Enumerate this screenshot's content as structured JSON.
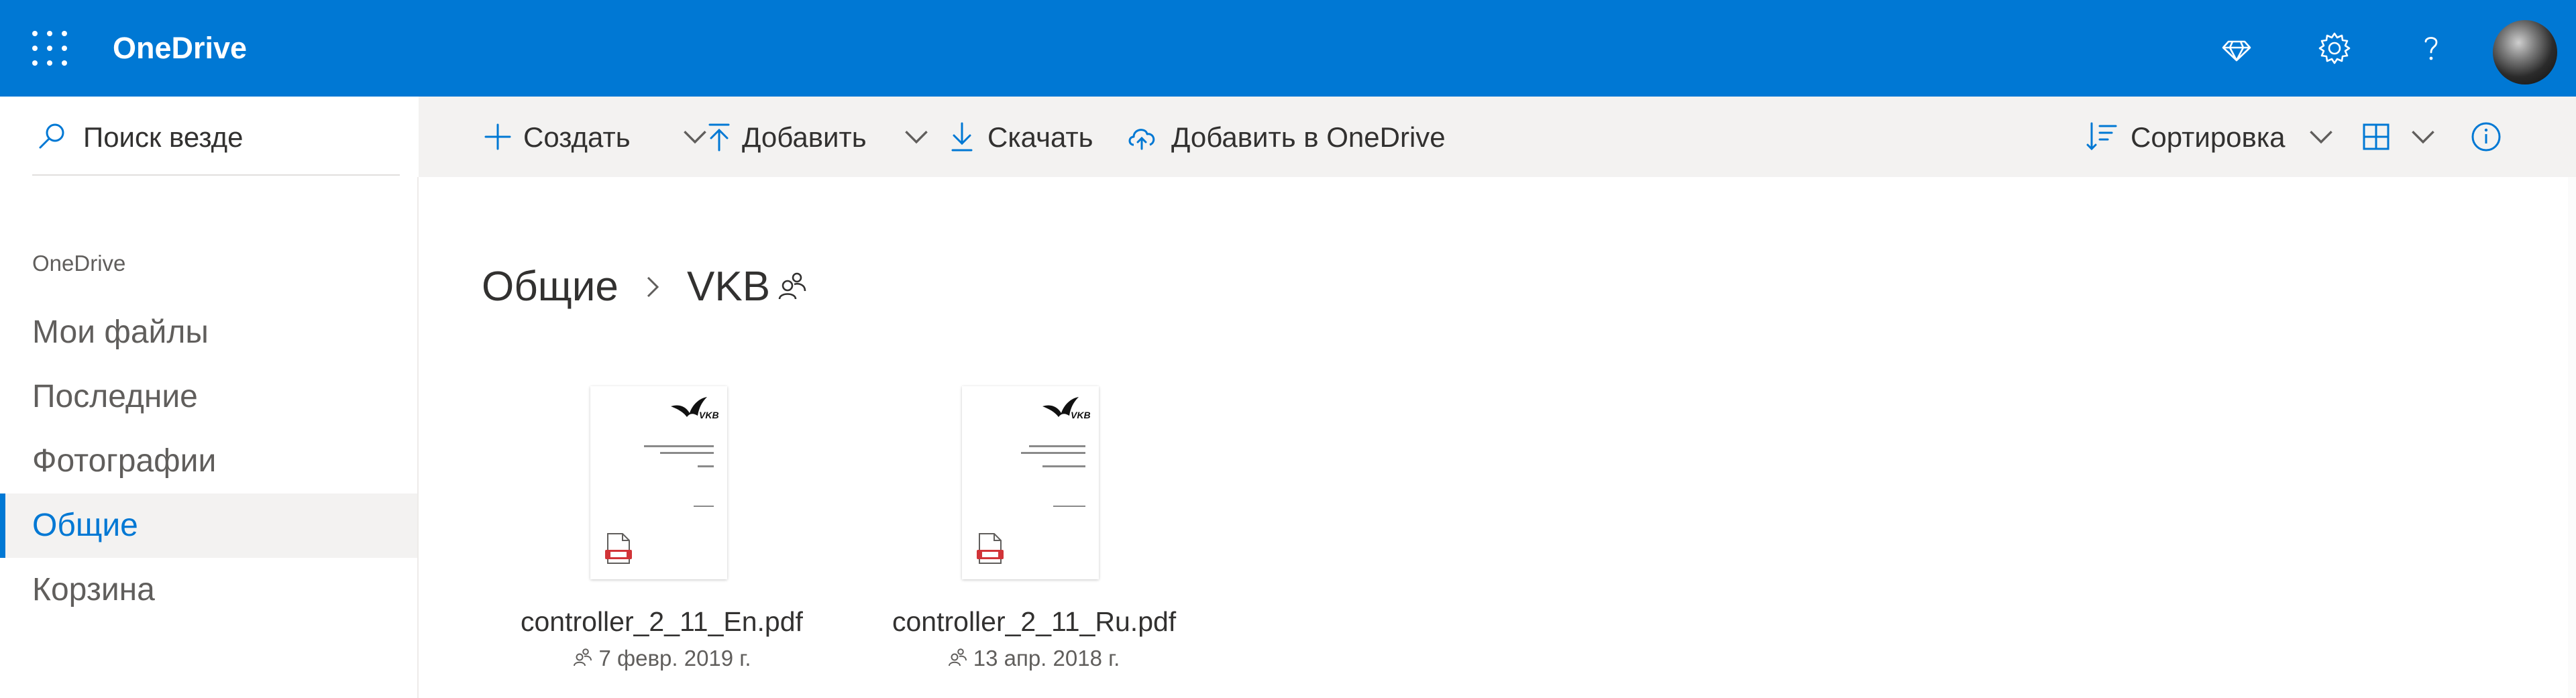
{
  "header": {
    "app_title": "OneDrive",
    "icons": [
      "waffle-icon",
      "diamond-icon",
      "gear-icon",
      "help-icon"
    ],
    "brand_color": "#0078d4"
  },
  "search": {
    "placeholder": "Поиск везде"
  },
  "sidebar": {
    "section_title": "OneDrive",
    "items": [
      {
        "label": "Мои файлы",
        "active": false
      },
      {
        "label": "Последние",
        "active": false
      },
      {
        "label": "Фотографии",
        "active": false
      },
      {
        "label": "Общие",
        "active": true
      },
      {
        "label": "Корзина",
        "active": false
      }
    ]
  },
  "commandbar": {
    "create_label": "Создать",
    "upload_label": "Добавить",
    "download_label": "Скачать",
    "add_to_onedrive_label": "Добавить в OneDrive",
    "sort_label": "Сортировка"
  },
  "breadcrumb": {
    "items": [
      "Общие",
      "VKB"
    ],
    "separator": ">"
  },
  "files": [
    {
      "name": "controller_2_11_En.pdf",
      "date": "7 февр. 2019 г.",
      "icon": "pdf-icon"
    },
    {
      "name": "controller_2_11_Ru.pdf",
      "date": "13 апр. 2018 г.",
      "icon": "pdf-icon"
    }
  ]
}
